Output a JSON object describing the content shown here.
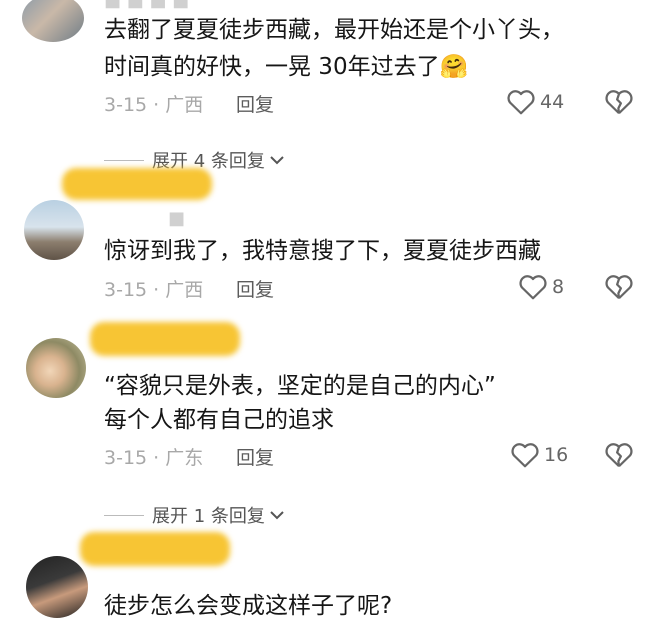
{
  "comments": [
    {
      "lines": [
        "去翻了夏夏徒步西藏，最开始还是个小丫头，",
        "时间真的好快，一晃 30年过去了"
      ],
      "emoji": "🤗",
      "meta": "3-15 · 广西",
      "reply_label": "回复",
      "likes": "44"
    },
    {
      "lines": [
        "惊讶到我了，我特意搜了下，夏夏徒步西藏"
      ],
      "meta": "3-15 · 广西",
      "reply_label": "回复",
      "likes": "8"
    },
    {
      "lines": [
        "“容貌只是外表，坚定的是自己的内心”",
        "每个人都有自己的追求"
      ],
      "meta": "3-15 · 广东",
      "reply_label": "回复",
      "likes": "16"
    },
    {
      "lines": [
        "徒步怎么会变成这样子了呢?"
      ]
    }
  ],
  "expand_replies": [
    {
      "label": "展开 4 条回复"
    },
    {
      "label": "展开 1 条回复"
    }
  ]
}
